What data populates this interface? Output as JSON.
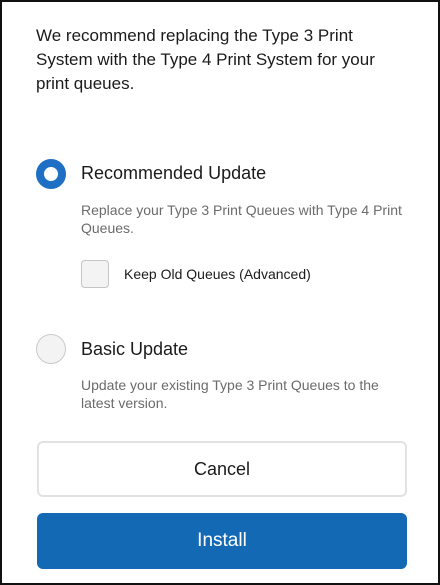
{
  "dialog": {
    "intro_text": "We recommend replacing the Type 3 Print System with the Type 4 Print System for your print queues."
  },
  "options": {
    "recommended": {
      "title": "Recommended Update",
      "description": "Replace your Type 3 Print Queues with Type 4 Print Queues.",
      "selected": true
    },
    "keep_old": {
      "label": "Keep Old Queues (Advanced)",
      "checked": false
    },
    "basic": {
      "title": "Basic Update",
      "description": "Update your existing Type 3 Print Queues to the latest version.",
      "selected": false
    }
  },
  "buttons": {
    "cancel": "Cancel",
    "install": "Install"
  },
  "colors": {
    "accent": "#1f6fc4",
    "install_bg": "#1469b5",
    "muted_text": "#6b6b6b"
  }
}
